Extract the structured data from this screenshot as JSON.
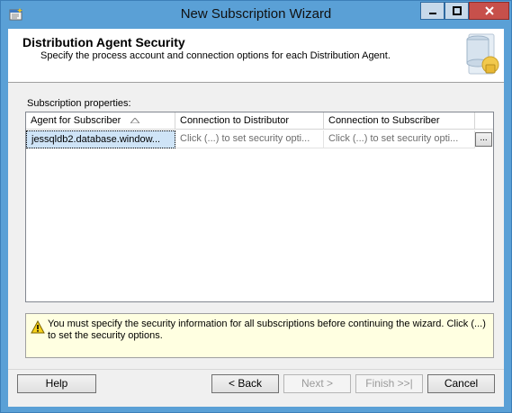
{
  "window": {
    "title": "New Subscription Wizard",
    "title_icon": "wizard-icon"
  },
  "header": {
    "title": "Distribution Agent Security",
    "subtitle": "Specify the process account and connection options for each Distribution Agent.",
    "icon": "database-security-icon"
  },
  "subscription_properties": {
    "label": "Subscription properties:",
    "columns": [
      "Agent for Subscriber",
      "Connection to Distributor",
      "Connection to Subscriber"
    ],
    "sort_column": "Agent for Subscriber",
    "rows": [
      {
        "agent": "jessqldb2.database.window...",
        "distributor": "Click (...) to set security opti...",
        "subscriber": "Click (...) to set security opti...",
        "button": "..."
      }
    ]
  },
  "warning": {
    "text": "You must specify the security information for all subscriptions before continuing the wizard. Click (...) to set the security options.",
    "icon": "warning-icon"
  },
  "buttons": {
    "help": "Help",
    "back": "< Back",
    "next": "Next >",
    "finish": "Finish >>|",
    "cancel": "Cancel"
  },
  "colors": {
    "titlebar": "#5aa0d6",
    "selected_cell": "#cfe4f7",
    "warning_bg": "#ffffe1",
    "close_button": "#c7504b"
  }
}
